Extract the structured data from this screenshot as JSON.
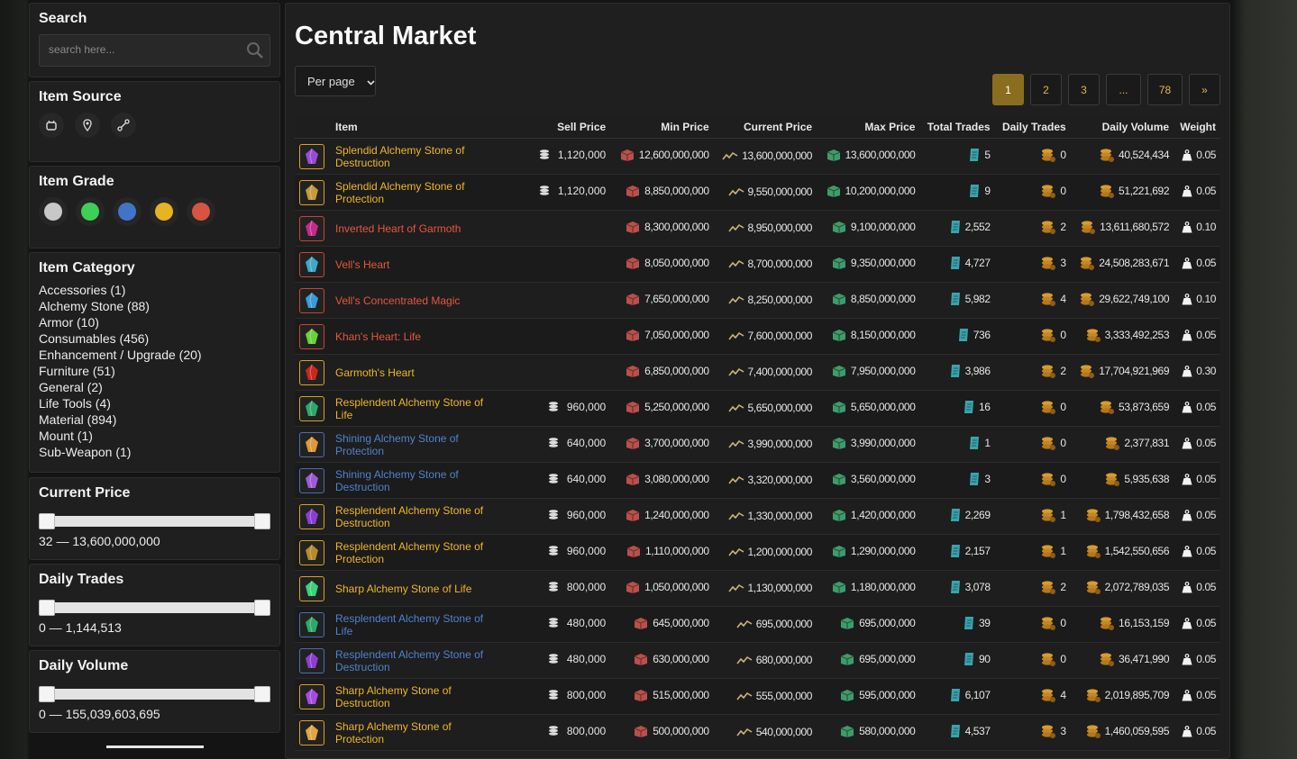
{
  "sidebar": {
    "search": {
      "title": "Search",
      "placeholder": "search here..."
    },
    "source": {
      "title": "Item Source",
      "icons": [
        "pot-icon",
        "location-pin-icon",
        "route-icon"
      ]
    },
    "grade": {
      "title": "Item Grade",
      "colors": [
        "#c8c8c8",
        "#3ecf55",
        "#3f74c8",
        "#e6b323",
        "#d65442"
      ]
    },
    "category": {
      "title": "Item Category",
      "items": [
        "Accessories (1)",
        "Alchemy Stone (88)",
        "Armor (10)",
        "Consumables (456)",
        "Enhancement / Upgrade (20)",
        "Furniture (51)",
        "General (2)",
        "Life Tools (4)",
        "Material (894)",
        "Mount (1)",
        "Sub-Weapon (1)"
      ]
    },
    "current_price": {
      "title": "Current Price",
      "range": "32 — 13,600,000,000"
    },
    "daily_trades": {
      "title": "Daily Trades",
      "range": "0 — 1,144,513"
    },
    "daily_volume": {
      "title": "Daily Volume",
      "range": "0 — 155,039,603,695"
    }
  },
  "main": {
    "title": "Central Market",
    "per_page": "Per page",
    "pages": [
      "1",
      "2",
      "3",
      "...",
      "78",
      "»"
    ],
    "active_page": "1",
    "columns": [
      "Item",
      "Sell Price",
      "Min Price",
      "Current Price",
      "Max Price",
      "Total Trades",
      "Daily Trades",
      "Daily Volume",
      "Weight"
    ],
    "rows": [
      {
        "name": "Splendid Alchemy Stone of Destruction",
        "grade": "yellow",
        "gem": "#9a4bd6",
        "sell": "1,120,000",
        "min": "12,600,000,000",
        "cur": "13,600,000,000",
        "max": "13,600,000,000",
        "total": "5",
        "daily": "0",
        "vol": "40,524,434",
        "weight": "0.05"
      },
      {
        "name": "Splendid Alchemy Stone of Protection",
        "grade": "yellow",
        "gem": "#c79a3a",
        "sell": "1,120,000",
        "min": "8,850,000,000",
        "cur": "9,550,000,000",
        "max": "10,200,000,000",
        "total": "9",
        "daily": "0",
        "vol": "51,221,692",
        "weight": "0.05"
      },
      {
        "name": "Inverted Heart of Garmoth",
        "grade": "red",
        "gem": "#c42a8c",
        "sell": "",
        "min": "8,300,000,000",
        "cur": "8,950,000,000",
        "max": "9,100,000,000",
        "total": "2,552",
        "daily": "2",
        "vol": "13,611,680,572",
        "weight": "0.10"
      },
      {
        "name": "Vell's Heart",
        "grade": "red",
        "gem": "#3fa7c9",
        "sell": "",
        "min": "8,050,000,000",
        "cur": "8,700,000,000",
        "max": "9,350,000,000",
        "total": "4,727",
        "daily": "3",
        "vol": "24,508,283,671",
        "weight": "0.05"
      },
      {
        "name": "Vell's Concentrated Magic",
        "grade": "red",
        "gem": "#3c9ad8",
        "sell": "",
        "min": "7,650,000,000",
        "cur": "8,250,000,000",
        "max": "8,850,000,000",
        "total": "5,982",
        "daily": "4",
        "vol": "29,622,749,100",
        "weight": "0.10"
      },
      {
        "name": "Khan's Heart: Life",
        "grade": "red",
        "gem": "#6bd13a",
        "sell": "",
        "min": "7,050,000,000",
        "cur": "7,600,000,000",
        "max": "8,150,000,000",
        "total": "736",
        "daily": "0",
        "vol": "3,333,492,253",
        "weight": "0.05"
      },
      {
        "name": "Garmoth's Heart",
        "grade": "yellow",
        "gem": "#c8281e",
        "sell": "",
        "min": "6,850,000,000",
        "cur": "7,400,000,000",
        "max": "7,950,000,000",
        "total": "3,986",
        "daily": "2",
        "vol": "17,704,921,969",
        "weight": "0.30"
      },
      {
        "name": "Resplendent Alchemy Stone of Life",
        "grade": "yellow",
        "gem": "#2ea86a",
        "sell": "960,000",
        "min": "5,250,000,000",
        "cur": "5,650,000,000",
        "max": "5,650,000,000",
        "total": "16",
        "daily": "0",
        "vol": "53,873,659",
        "weight": "0.05"
      },
      {
        "name": "Shining Alchemy Stone of Protection",
        "grade": "blue",
        "gem": "#d99a3b",
        "sell": "640,000",
        "min": "3,700,000,000",
        "cur": "3,990,000,000",
        "max": "3,990,000,000",
        "total": "1",
        "daily": "0",
        "vol": "2,377,831",
        "weight": "0.05"
      },
      {
        "name": "Shining Alchemy Stone of Destruction",
        "grade": "blue",
        "gem": "#9b5ad6",
        "sell": "640,000",
        "min": "3,080,000,000",
        "cur": "3,320,000,000",
        "max": "3,560,000,000",
        "total": "3",
        "daily": "0",
        "vol": "5,935,638",
        "weight": "0.05"
      },
      {
        "name": "Resplendent Alchemy Stone of Destruction",
        "grade": "yellow",
        "gem": "#8a3fd0",
        "sell": "960,000",
        "min": "1,240,000,000",
        "cur": "1,330,000,000",
        "max": "1,420,000,000",
        "total": "2,269",
        "daily": "1",
        "vol": "1,798,432,658",
        "weight": "0.05"
      },
      {
        "name": "Resplendent Alchemy Stone of Protection",
        "grade": "yellow",
        "gem": "#b78a2a",
        "sell": "960,000",
        "min": "1,110,000,000",
        "cur": "1,200,000,000",
        "max": "1,290,000,000",
        "total": "2,157",
        "daily": "1",
        "vol": "1,542,550,656",
        "weight": "0.05"
      },
      {
        "name": "Sharp Alchemy Stone of Life",
        "grade": "yellow",
        "gem": "#3cd17a",
        "sell": "800,000",
        "min": "1,050,000,000",
        "cur": "1,130,000,000",
        "max": "1,180,000,000",
        "total": "3,078",
        "daily": "2",
        "vol": "2,072,789,035",
        "weight": "0.05"
      },
      {
        "name": "Resplendent Alchemy Stone of Life",
        "grade": "blue",
        "gem": "#2ea86a",
        "sell": "480,000",
        "min": "645,000,000",
        "cur": "695,000,000",
        "max": "695,000,000",
        "total": "39",
        "daily": "0",
        "vol": "16,153,159",
        "weight": "0.05"
      },
      {
        "name": "Resplendent Alchemy Stone of Destruction",
        "grade": "blue",
        "gem": "#8a3fd0",
        "sell": "480,000",
        "min": "630,000,000",
        "cur": "680,000,000",
        "max": "695,000,000",
        "total": "90",
        "daily": "0",
        "vol": "36,471,990",
        "weight": "0.05"
      },
      {
        "name": "Sharp Alchemy Stone of Destruction",
        "grade": "yellow",
        "gem": "#a54be0",
        "sell": "800,000",
        "min": "515,000,000",
        "cur": "555,000,000",
        "max": "595,000,000",
        "total": "6,107",
        "daily": "4",
        "vol": "2,019,895,709",
        "weight": "0.05"
      },
      {
        "name": "Sharp Alchemy Stone of Protection",
        "grade": "yellow",
        "gem": "#e0a640",
        "sell": "800,000",
        "min": "500,000,000",
        "cur": "540,000,000",
        "max": "580,000,000",
        "total": "4,537",
        "daily": "3",
        "vol": "1,460,059,595",
        "weight": "0.05"
      }
    ]
  }
}
